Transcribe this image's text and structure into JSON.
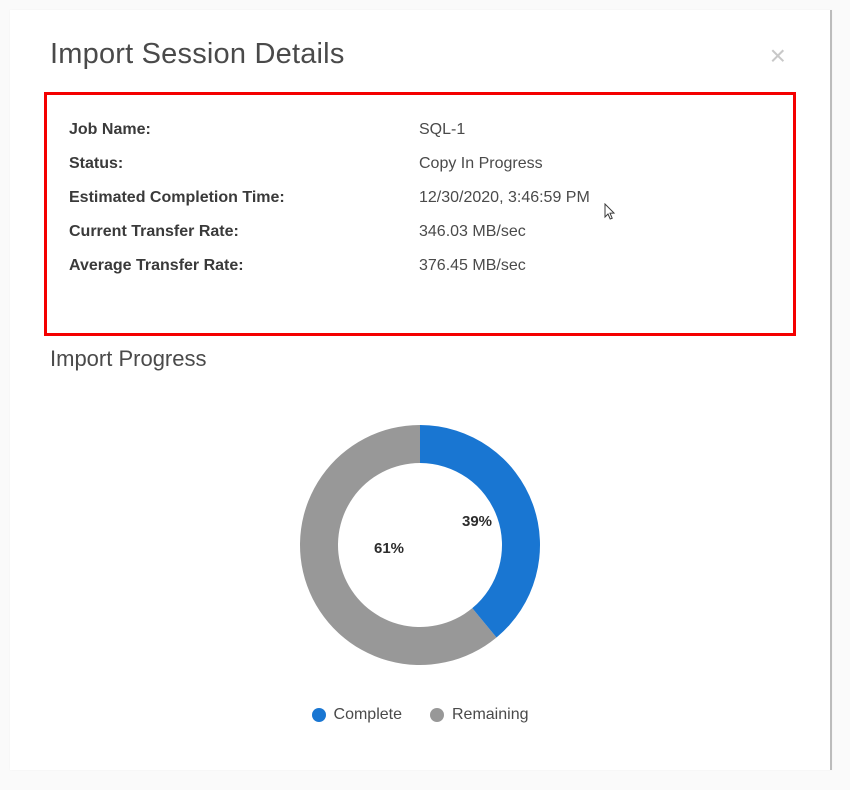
{
  "header": {
    "title": "Import Session Details"
  },
  "details": {
    "job_name_label": "Job Name:",
    "job_name_value": "SQL-1",
    "status_label": "Status:",
    "status_value": "Copy In Progress",
    "eta_label": "Estimated Completion Time:",
    "eta_value": "12/30/2020, 3:46:59 PM",
    "current_rate_label": "Current Transfer Rate:",
    "current_rate_value": "346.03 MB/sec",
    "average_rate_label": "Average Transfer Rate:",
    "average_rate_value": "376.45 MB/sec"
  },
  "progress": {
    "title": "Import Progress",
    "complete_pct_text": "39%",
    "remaining_pct_text": "61%",
    "legend_complete": "Complete",
    "legend_remaining": "Remaining"
  },
  "chart_data": {
    "type": "pie",
    "title": "Import Progress",
    "series": [
      {
        "name": "Complete",
        "value": 39,
        "color": "#1976d2"
      },
      {
        "name": "Remaining",
        "value": 61,
        "color": "#989898"
      }
    ],
    "donut": true
  },
  "colors": {
    "complete": "#1976d2",
    "remaining": "#989898",
    "highlight_border": "#f40000"
  }
}
